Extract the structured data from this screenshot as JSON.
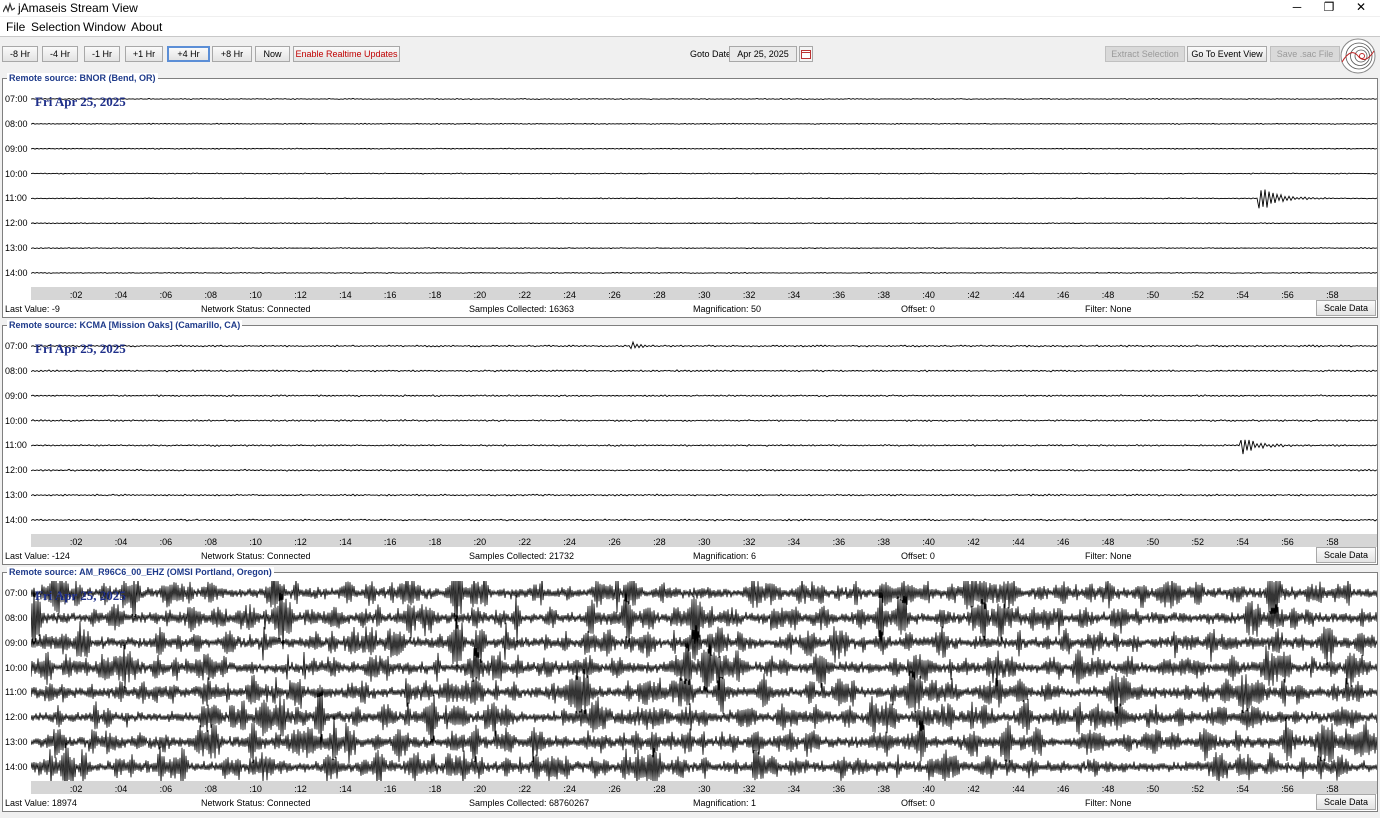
{
  "window": {
    "title": "jAmaseis Stream View",
    "minimize": "─",
    "restore": "❐",
    "close": "✕"
  },
  "menu": [
    "File",
    "Selection",
    "Window",
    "About"
  ],
  "toolbar": {
    "buttons": [
      "-8 Hr",
      "-4 Hr",
      "-1 Hr",
      "+1 Hr",
      "+4 Hr",
      "+8 Hr",
      "Now"
    ],
    "active_button": "+4 Hr",
    "realtime": "Enable Realtime Updates",
    "goto_label": "Goto Date:",
    "goto_value": "Apr 25, 2025",
    "extract": "Extract Selection",
    "event_view": "Go To Event View",
    "save_sac": "Save .sac File"
  },
  "hours": [
    "07:00",
    "08:00",
    "09:00",
    "10:00",
    "11:00",
    "12:00",
    "13:00",
    "14:00"
  ],
  "minute_ticks": [
    ":02",
    ":04",
    ":06",
    ":08",
    ":10",
    ":12",
    ":14",
    ":16",
    ":18",
    ":20",
    ":22",
    ":24",
    ":26",
    ":28",
    ":30",
    ":32",
    ":34",
    ":36",
    ":38",
    ":40",
    ":42",
    ":44",
    ":46",
    ":48",
    ":50",
    ":52",
    ":54",
    ":56",
    ":58"
  ],
  "panels": [
    {
      "title": "Remote source: BNOR (Bend, OR)",
      "date": "Fri Apr 25, 2025",
      "last_value": "Last Value:  -9",
      "network": "Network Status:  Connected",
      "samples": "Samples Collected:  16363",
      "magnification": "Magnification:  50",
      "offset": "Offset:  0",
      "filter": "Filter:  None",
      "scale": "Scale Data",
      "noise_level": 0.6,
      "events": [
        {
          "row": 4,
          "minute": 54.8,
          "amp": 14,
          "dur": 3.0
        }
      ]
    },
    {
      "title": "Remote source: KCMA [Mission Oaks] (Camarillo, CA)",
      "date": "Fri Apr 25, 2025",
      "last_value": "Last Value:  -124",
      "network": "Network Status:  Connected",
      "samples": "Samples Collected:  21732",
      "magnification": "Magnification:  6",
      "offset": "Offset:  0",
      "filter": "Filter:  None",
      "scale": "Scale Data",
      "noise_level": 1.0,
      "events": [
        {
          "row": 0,
          "minute": 26.8,
          "amp": 3,
          "dur": 1.5
        },
        {
          "row": 4,
          "minute": 54.0,
          "amp": 9,
          "dur": 2.5
        }
      ]
    },
    {
      "title": "Remote source: AM_R96C6_00_EHZ (OMSI Portland, Oregon)",
      "date": "Fri Apr 25, 2025",
      "last_value": "Last Value:  18974",
      "network": "Network Status:  Connected",
      "samples": "Samples Collected:  68760267",
      "magnification": "Magnification:  1",
      "offset": "Offset:  0",
      "filter": "Filter:  None",
      "scale": "Scale Data",
      "noise_level": 7.0,
      "events": []
    }
  ]
}
